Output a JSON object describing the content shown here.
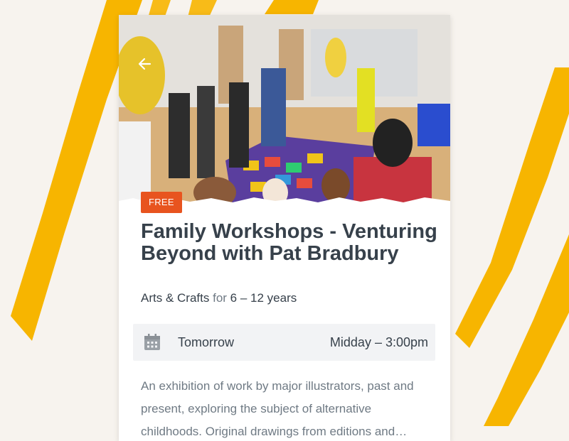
{
  "event": {
    "price_badge": "FREE",
    "title": "Family Workshops - Venturing Beyond with Pat Bradbury",
    "category": "Arts & Crafts",
    "age_connector": "for",
    "age_range": "6 – 12 years",
    "date": "Tomorrow",
    "time": "Midday – 3:00pm",
    "description": "An exhibition of work by major illustrators, past and present, exploring the subject of alternative childhoods. Original drawings from editions and…"
  },
  "icons": {
    "back": "back-arrow-icon",
    "date": "calendar-icon"
  },
  "colors": {
    "background": "#f7f3ee",
    "stroke_accent": "#f7b500",
    "badge": "#e8541f",
    "title_text": "#37414b",
    "muted_text": "#6f7a84",
    "info_bar": "#f2f3f5"
  }
}
